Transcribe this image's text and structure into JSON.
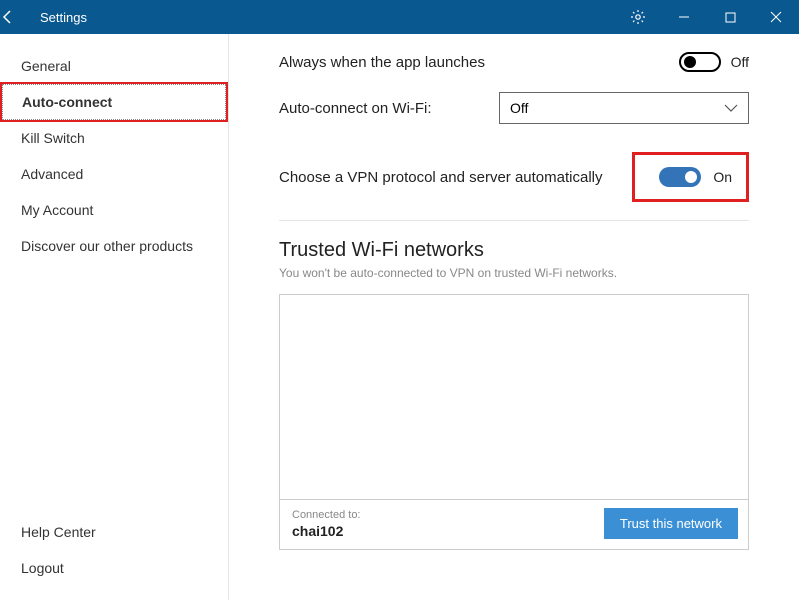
{
  "titlebar": {
    "title": "Settings"
  },
  "sidebar": {
    "items": [
      {
        "label": "General"
      },
      {
        "label": "Auto-connect"
      },
      {
        "label": "Kill Switch"
      },
      {
        "label": "Advanced"
      },
      {
        "label": "My Account"
      },
      {
        "label": "Discover our other products"
      }
    ],
    "footer": [
      {
        "label": "Help Center"
      },
      {
        "label": "Logout"
      }
    ]
  },
  "content": {
    "launch_row": {
      "label": "Always when the app launches",
      "state_text": "Off"
    },
    "wifi_row": {
      "label": "Auto-connect on Wi-Fi:",
      "selected": "Off"
    },
    "protocol_row": {
      "label": "Choose a VPN protocol and server automatically",
      "state_text": "On"
    },
    "trusted": {
      "title": "Trusted Wi-Fi networks",
      "subtitle": "You won't be auto-connected to VPN on trusted Wi-Fi networks.",
      "connected_label": "Connected to:",
      "connected_name": "chai102",
      "trust_button": "Trust this network"
    }
  }
}
